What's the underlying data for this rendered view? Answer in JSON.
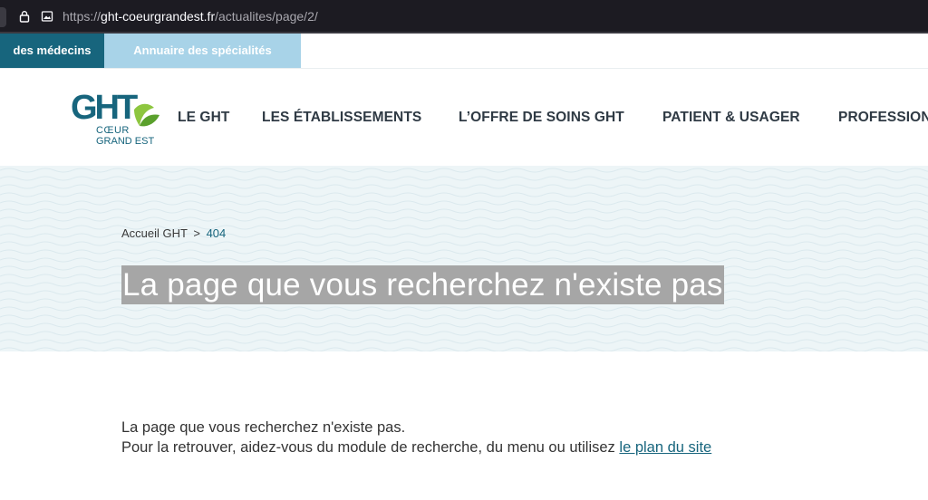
{
  "browser": {
    "url_prefix": "https://",
    "url_domain": "ght-coeurgrandest.fr",
    "url_path": "/actualites/page/2/"
  },
  "top_links": {
    "doctors": "des médecins",
    "directory": "Annuaire des spécialités"
  },
  "logo": {
    "letters": "GHT",
    "line1": "CŒUR",
    "line2": "GRAND EST"
  },
  "nav": {
    "items": [
      "LE GHT",
      "LES ÉTABLISSEMENTS",
      "L’OFFRE DE SOINS GHT",
      "PATIENT & USAGER",
      "PROFESSIONNELS"
    ]
  },
  "breadcrumb": {
    "home": "Accueil GHT",
    "separator": ">",
    "current": "404"
  },
  "hero": {
    "title": "La page que vous recherchez n'existe pas"
  },
  "content": {
    "line1": "La page que vous recherchez n'existe pas.",
    "line2": "Pour la retrouver, aidez-vous du module de recherche, du menu ou utilisez",
    "link": "le plan du site"
  },
  "colors": {
    "brand_teal": "#17657d",
    "light_blue": "#a8d3e8",
    "hero_bg": "#edf5f7",
    "logo_green": "#8dc63f"
  }
}
